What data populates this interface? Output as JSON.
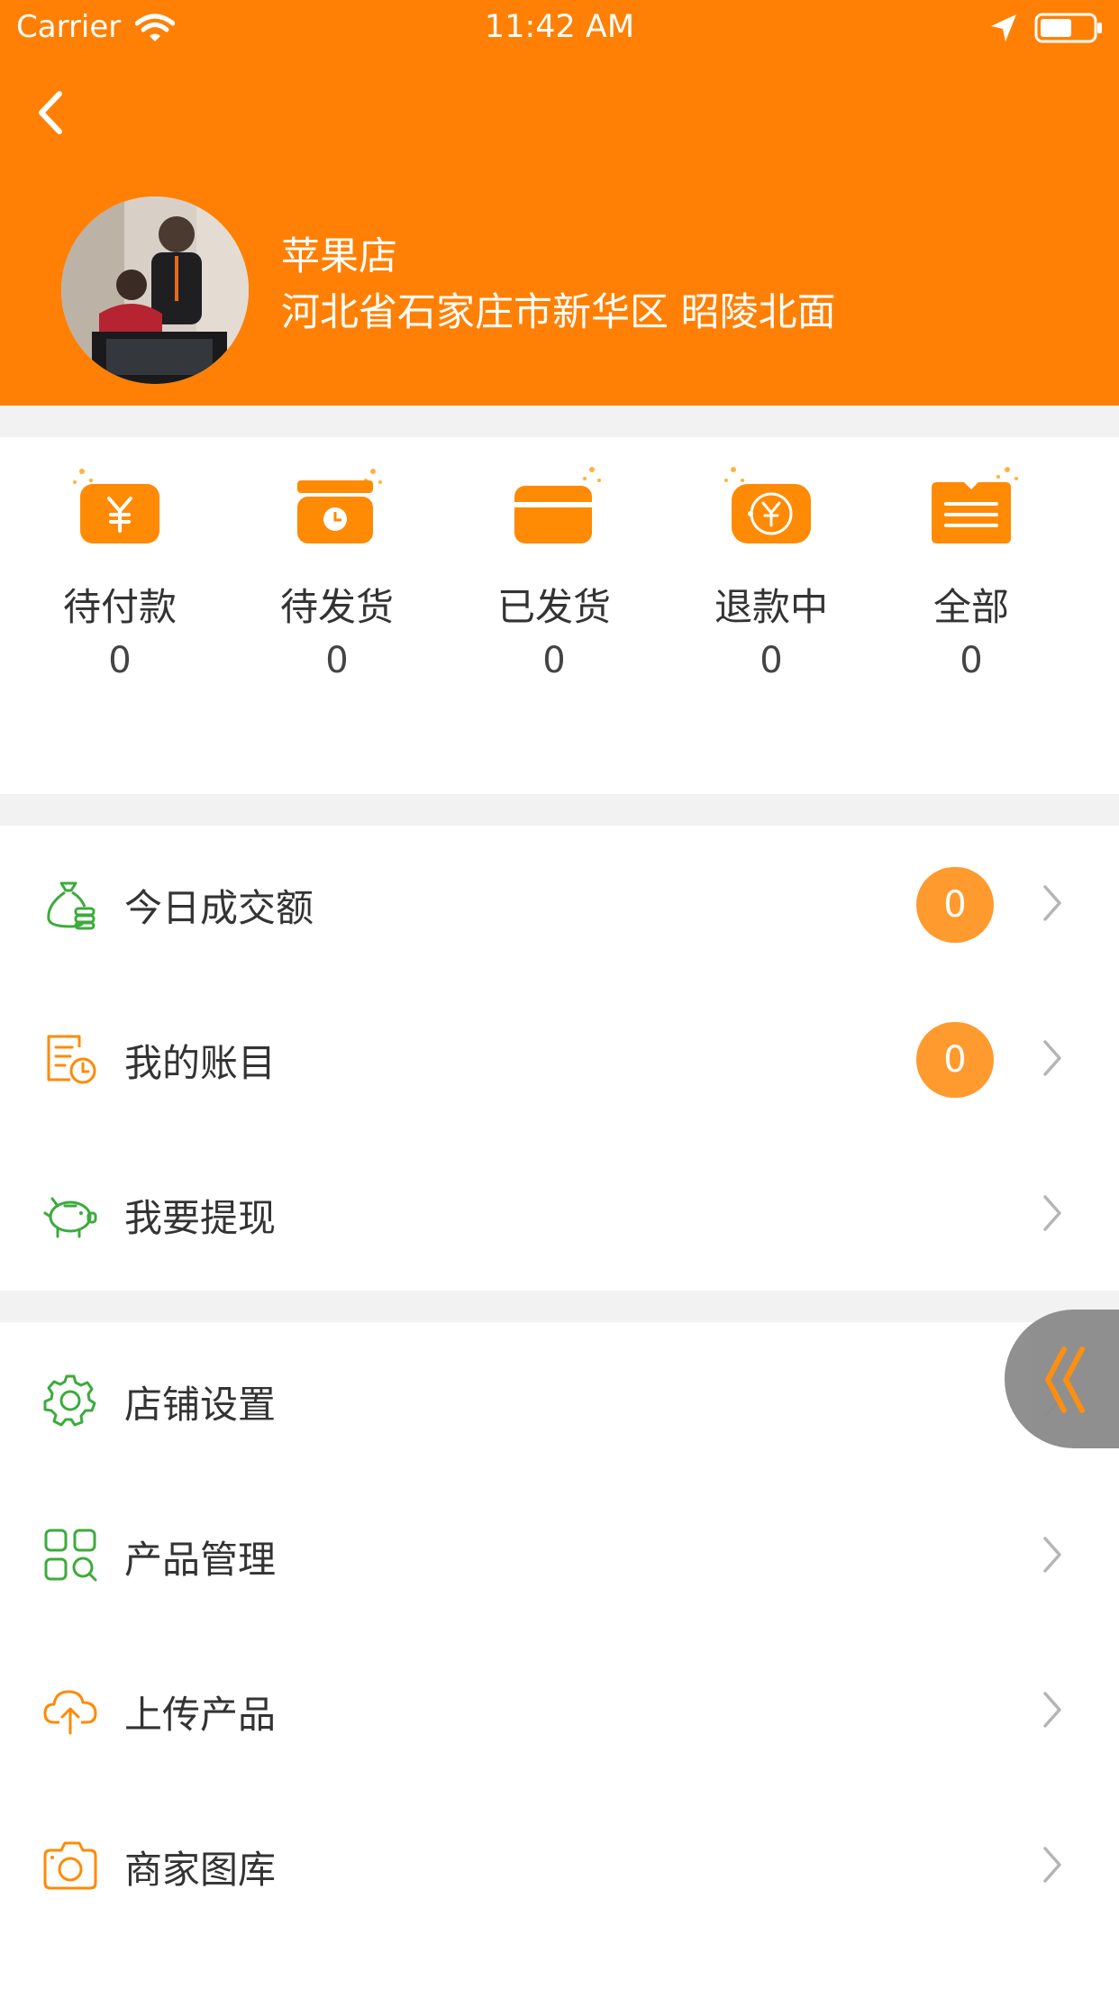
{
  "status_bar": {
    "carrier": "Carrier",
    "time": "11:42 AM"
  },
  "store": {
    "name": "苹果店",
    "address": "河北省石家庄市新华区 昭陵北面"
  },
  "orders": [
    {
      "label": "待付款",
      "count": "0",
      "icon": "yen-bag-icon"
    },
    {
      "label": "待发货",
      "count": "0",
      "icon": "pending-box-icon"
    },
    {
      "label": "已发货",
      "count": "0",
      "icon": "card-icon"
    },
    {
      "label": "退款中",
      "count": "0",
      "icon": "refund-icon"
    },
    {
      "label": "全部",
      "count": "0",
      "icon": "all-list-icon"
    }
  ],
  "finance_menu": [
    {
      "label": "今日成交额",
      "badge": "0",
      "icon": "money-bag-icon"
    },
    {
      "label": "我的账目",
      "badge": "0",
      "icon": "ledger-icon"
    },
    {
      "label": "我要提现",
      "icon": "piggy-bank-icon"
    }
  ],
  "store_menu": [
    {
      "label": "店铺设置",
      "icon": "gear-icon"
    },
    {
      "label": "产品管理",
      "icon": "grid-search-icon"
    },
    {
      "label": "上传产品",
      "icon": "cloud-upload-icon"
    },
    {
      "label": "商家图库",
      "icon": "camera-icon"
    }
  ],
  "colors": {
    "header": "#ff8004",
    "accent_orange": "#ff9a2e",
    "icon_green": "#3cab3c"
  }
}
